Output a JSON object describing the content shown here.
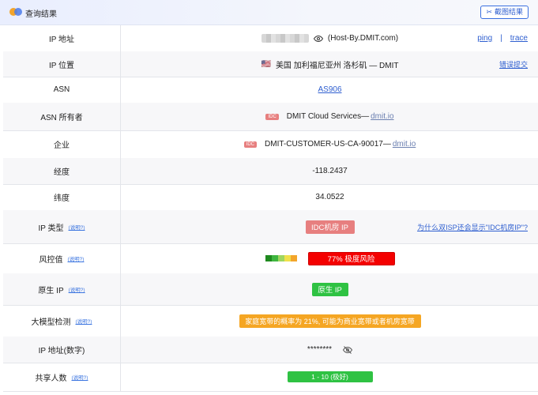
{
  "header": {
    "title": "查询结果",
    "screenshot_button": "截图结果"
  },
  "rows": [
    {
      "label": "IP 地址",
      "value": "(Host-By.DMIT.com)",
      "links": [
        "ping",
        "|",
        "trace"
      ]
    },
    {
      "label": "IP 位置",
      "flag": "🇺🇸",
      "value": "美国 加利福尼亚州 洛杉矶 — DMIT",
      "right_link": "错误提交"
    },
    {
      "label": "ASN",
      "value": "AS906"
    },
    {
      "label": "ASN 所有者",
      "badge": "IDC",
      "value": "DMIT Cloud Services—",
      "domain": "dmit.io"
    },
    {
      "label": "企业",
      "badge": "IDC",
      "value": "DMIT-CUSTOMER-US-CA-90017—",
      "domain": "dmit.io"
    },
    {
      "label": "经度",
      "value": "-118.2437"
    },
    {
      "label": "纬度",
      "value": "34.0522"
    },
    {
      "label": "IP 类型",
      "help": "(说明?)",
      "value": "IDC机房 IP",
      "right_link": "为什么双ISP还会显示\"IDC机房IP\"?"
    },
    {
      "label": "风控值",
      "help": "(说明?)",
      "value": "77%  极度风险",
      "risk_score": 0.77
    },
    {
      "label": "原生 IP",
      "help": "(说明?)",
      "value": "原生 IP"
    },
    {
      "label": "大模型检测",
      "help": "(说明?)",
      "value": "家庭宽带的概率为 21%, 可能为商业宽带或者机房宽带"
    },
    {
      "label": "IP 地址(数字)",
      "value": "********"
    },
    {
      "label": "共享人数",
      "help": "(说明?)",
      "value": "1 - 10 (极好)"
    }
  ],
  "colors": {
    "accent": "#2f5fd0",
    "idc": "#e77f7f",
    "risk": "#f40000",
    "good": "#2fc243",
    "warn": "#f5a623"
  },
  "icons": {
    "eye": "eye-icon",
    "eye_off": "eye-off-icon",
    "scissors": "scissors-icon"
  }
}
